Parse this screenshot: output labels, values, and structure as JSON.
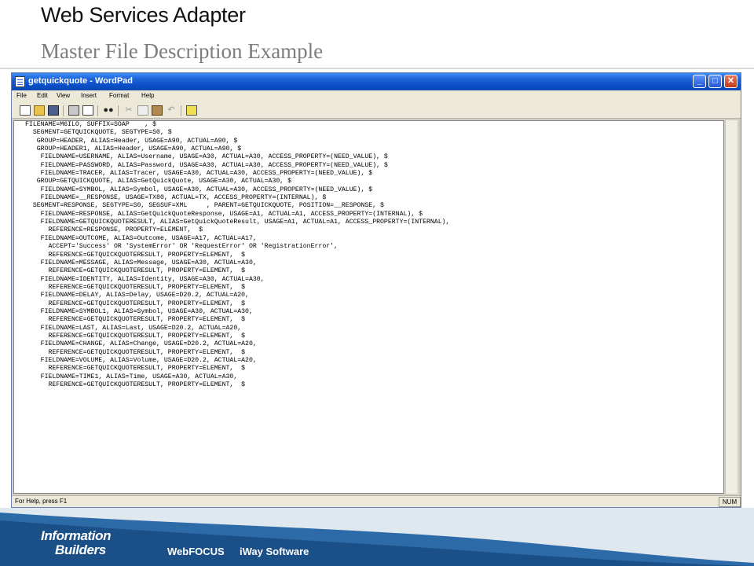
{
  "slide": {
    "title": "Web Services Adapter",
    "subtitle": "Master File Description Example"
  },
  "window": {
    "title": "getquickquote - WordPad",
    "controls": {
      "minimize": "_",
      "maximize": "□",
      "close": "✕"
    }
  },
  "menu": [
    "File",
    "Edit",
    "View",
    "Insert",
    "Format",
    "Help"
  ],
  "toolbar_icons": [
    "new-icon",
    "open-icon",
    "save-icon",
    "print-icon",
    "print-preview-icon",
    "find-icon",
    "cut-icon",
    "copy-icon",
    "paste-icon",
    "undo-icon",
    "date-time-icon"
  ],
  "document": {
    "text": "FILENAME=M6ILO, SUFFIX=SOAP    , $\n  SEGMENT=GETQUICKQUOTE, SEGTYPE=S0, $\n   GROUP=HEADER, ALIAS=Header, USAGE=A90, ACTUAL=A90, $\n   GROUP=HEADER1, ALIAS=Header, USAGE=A90, ACTUAL=A90, $\n    FIELDNAME=USERNAME, ALIAS=Username, USAGE=A30, ACTUAL=A30, ACCESS_PROPERTY=(NEED_VALUE), $\n    FIELDNAME=PASSWORD, ALIAS=Password, USAGE=A30, ACTUAL=A30, ACCESS_PROPERTY=(NEED_VALUE), $\n    FIELDNAME=TRACER, ALIAS=Tracer, USAGE=A30, ACTUAL=A30, ACCESS_PROPERTY=(NEED_VALUE), $\n   GROUP=GETQUICKQUOTE, ALIAS=GetQuickQuote, USAGE=A30, ACTUAL=A30, $\n    FIELDNAME=SYMBOL, ALIAS=Symbol, USAGE=A30, ACTUAL=A30, ACCESS_PROPERTY=(NEED_VALUE), $\n    FIELDNAME=__RESPONSE, USAGE=TX80, ACTUAL=TX, ACCESS_PROPERTY=(INTERNAL), $\n  SEGMENT=RESPONSE, SEGTYPE=S0, SEGSUF=XML     , PARENT=GETQUICKQUOTE, POSITION=__RESPONSE, $\n    FIELDNAME=RESPONSE, ALIAS=GetQuickQuoteResponse, USAGE=A1, ACTUAL=A1, ACCESS_PROPERTY=(INTERNAL), $\n    FIELDNAME=GETQUICKQUOTERESULT, ALIAS=GetQuickQuoteResult, USAGE=A1, ACTUAL=A1, ACCESS_PROPERTY=(INTERNAL),\n      REFERENCE=RESPONSE, PROPERTY=ELEMENT,  $\n    FIELDNAME=OUTCOME, ALIAS=Outcome, USAGE=A17, ACTUAL=A17,\n      ACCEPT='Success' OR 'SystemError' OR 'RequestError' OR 'RegistrationError',\n      REFERENCE=GETQUICKQUOTERESULT, PROPERTY=ELEMENT,  $\n    FIELDNAME=MESSAGE, ALIAS=Message, USAGE=A30, ACTUAL=A30,\n      REFERENCE=GETQUICKQUOTERESULT, PROPERTY=ELEMENT,  $\n    FIELDNAME=IDENTITY, ALIAS=Identity, USAGE=A30, ACTUAL=A30,\n      REFERENCE=GETQUICKQUOTERESULT, PROPERTY=ELEMENT,  $\n    FIELDNAME=DELAY, ALIAS=Delay, USAGE=D20.2, ACTUAL=A20,\n      REFERENCE=GETQUICKQUOTERESULT, PROPERTY=ELEMENT,  $\n    FIELDNAME=SYMBOL1, ALIAS=Symbol, USAGE=A30, ACTUAL=A30,\n      REFERENCE=GETQUICKQUOTERESULT, PROPERTY=ELEMENT,  $\n    FIELDNAME=LAST, ALIAS=Last, USAGE=D20.2, ACTUAL=A20,\n      REFERENCE=GETQUICKQUOTERESULT, PROPERTY=ELEMENT,  $\n    FIELDNAME=CHANGE, ALIAS=Change, USAGE=D20.2, ACTUAL=A20,\n      REFERENCE=GETQUICKQUOTERESULT, PROPERTY=ELEMENT,  $\n    FIELDNAME=VOLUME, ALIAS=Volume, USAGE=D20.2, ACTUAL=A20,\n      REFERENCE=GETQUICKQUOTERESULT, PROPERTY=ELEMENT,  $\n    FIELDNAME=TIME1, ALIAS=Time, USAGE=A30, ACTUAL=A30,\n      REFERENCE=GETQUICKQUOTERESULT, PROPERTY=ELEMENT,  $"
  },
  "statusbar": {
    "help": "For Help, press F1",
    "num": "NUM"
  },
  "footer": {
    "logo_line1": "Information",
    "logo_line2": "Builders",
    "link1": "WebFOCUS",
    "link2": "iWay Software"
  },
  "colors": {
    "titlebar": "#0a4fc9",
    "footer_dark": "#1b4f87",
    "footer_mid": "#2d6aa8",
    "footer_light": "#dfe7ef"
  }
}
